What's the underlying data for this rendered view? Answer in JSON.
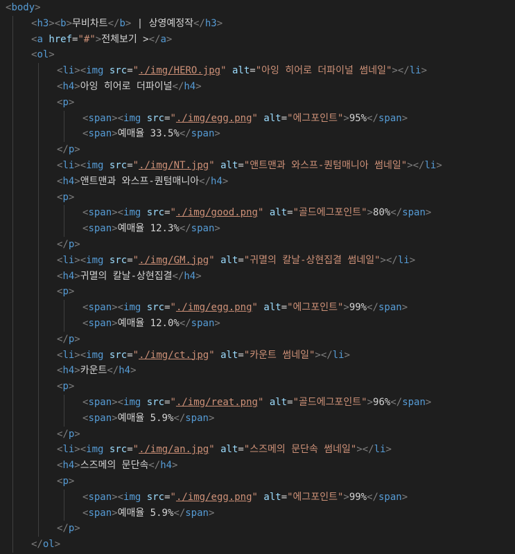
{
  "lines": [
    {
      "depth": 0,
      "tokens": [
        [
          "p",
          "<"
        ],
        [
          "t",
          "body"
        ],
        [
          "p",
          ">"
        ]
      ]
    },
    {
      "depth": 1,
      "tokens": [
        [
          "p",
          "<"
        ],
        [
          "t",
          "h3"
        ],
        [
          "p",
          ">"
        ],
        [
          "p",
          "<"
        ],
        [
          "t",
          "b"
        ],
        [
          "p",
          ">"
        ],
        [
          "x",
          "무비차트"
        ],
        [
          "p",
          "</"
        ],
        [
          "t",
          "b"
        ],
        [
          "p",
          ">"
        ],
        [
          "x",
          " | 상영예정작"
        ],
        [
          "p",
          "</"
        ],
        [
          "t",
          "h3"
        ],
        [
          "p",
          ">"
        ]
      ]
    },
    {
      "depth": 1,
      "tokens": [
        [
          "p",
          "<"
        ],
        [
          "t",
          "a"
        ],
        [
          "x",
          " "
        ],
        [
          "a",
          "href"
        ],
        [
          "e",
          "="
        ],
        [
          "s",
          "\"#\""
        ],
        [
          "p",
          ">"
        ],
        [
          "x",
          "전체보기 >"
        ],
        [
          "p",
          "</"
        ],
        [
          "t",
          "a"
        ],
        [
          "p",
          ">"
        ]
      ]
    },
    {
      "depth": 1,
      "tokens": [
        [
          "p",
          "<"
        ],
        [
          "t",
          "ol"
        ],
        [
          "p",
          ">"
        ]
      ]
    },
    {
      "depth": 2,
      "tokens": [
        [
          "p",
          "<"
        ],
        [
          "t",
          "li"
        ],
        [
          "p",
          ">"
        ],
        [
          "p",
          "<"
        ],
        [
          "t",
          "img"
        ],
        [
          "x",
          " "
        ],
        [
          "a",
          "src"
        ],
        [
          "e",
          "="
        ],
        [
          "s",
          "\""
        ],
        [
          "sl",
          "./img/HERO.jpg"
        ],
        [
          "s",
          "\""
        ],
        [
          "x",
          " "
        ],
        [
          "a",
          "alt"
        ],
        [
          "e",
          "="
        ],
        [
          "s",
          "\"아잉 히어로 더파이널 썸네일\""
        ],
        [
          "p",
          ">"
        ],
        [
          "p",
          "</"
        ],
        [
          "t",
          "li"
        ],
        [
          "p",
          ">"
        ]
      ]
    },
    {
      "depth": 2,
      "tokens": [
        [
          "p",
          "<"
        ],
        [
          "t",
          "h4"
        ],
        [
          "p",
          ">"
        ],
        [
          "x",
          "아잉 히어로 더파이널"
        ],
        [
          "p",
          "</"
        ],
        [
          "t",
          "h4"
        ],
        [
          "p",
          ">"
        ]
      ]
    },
    {
      "depth": 2,
      "tokens": [
        [
          "p",
          "<"
        ],
        [
          "t",
          "p"
        ],
        [
          "p",
          ">"
        ]
      ]
    },
    {
      "depth": 3,
      "tokens": [
        [
          "p",
          "<"
        ],
        [
          "t",
          "span"
        ],
        [
          "p",
          ">"
        ],
        [
          "p",
          "<"
        ],
        [
          "t",
          "img"
        ],
        [
          "x",
          " "
        ],
        [
          "a",
          "src"
        ],
        [
          "e",
          "="
        ],
        [
          "s",
          "\""
        ],
        [
          "sl",
          "./img/egg.png"
        ],
        [
          "s",
          "\""
        ],
        [
          "x",
          " "
        ],
        [
          "a",
          "alt"
        ],
        [
          "e",
          "="
        ],
        [
          "s",
          "\"에그포인트\""
        ],
        [
          "p",
          ">"
        ],
        [
          "x",
          "95%"
        ],
        [
          "p",
          "</"
        ],
        [
          "t",
          "span"
        ],
        [
          "p",
          ">"
        ]
      ]
    },
    {
      "depth": 3,
      "tokens": [
        [
          "p",
          "<"
        ],
        [
          "t",
          "span"
        ],
        [
          "p",
          ">"
        ],
        [
          "x",
          "예매율 33.5%"
        ],
        [
          "p",
          "</"
        ],
        [
          "t",
          "span"
        ],
        [
          "p",
          ">"
        ]
      ]
    },
    {
      "depth": 2,
      "tokens": [
        [
          "p",
          "</"
        ],
        [
          "t",
          "p"
        ],
        [
          "p",
          ">"
        ]
      ]
    },
    {
      "depth": 2,
      "tokens": [
        [
          "p",
          "<"
        ],
        [
          "t",
          "li"
        ],
        [
          "p",
          ">"
        ],
        [
          "p",
          "<"
        ],
        [
          "t",
          "img"
        ],
        [
          "x",
          " "
        ],
        [
          "a",
          "src"
        ],
        [
          "e",
          "="
        ],
        [
          "s",
          "\""
        ],
        [
          "sl",
          "./img/NT.jpg"
        ],
        [
          "s",
          "\""
        ],
        [
          "x",
          " "
        ],
        [
          "a",
          "alt"
        ],
        [
          "e",
          "="
        ],
        [
          "s",
          "\"앤트맨과 와스프-퀀텀매니아 썸네일\""
        ],
        [
          "p",
          ">"
        ],
        [
          "p",
          "</"
        ],
        [
          "t",
          "li"
        ],
        [
          "p",
          ">"
        ]
      ]
    },
    {
      "depth": 2,
      "tokens": [
        [
          "p",
          "<"
        ],
        [
          "t",
          "h4"
        ],
        [
          "p",
          ">"
        ],
        [
          "x",
          "앤트맨과 와스프-퀀텀매니아"
        ],
        [
          "p",
          "</"
        ],
        [
          "t",
          "h4"
        ],
        [
          "p",
          ">"
        ]
      ]
    },
    {
      "depth": 2,
      "tokens": [
        [
          "p",
          "<"
        ],
        [
          "t",
          "p"
        ],
        [
          "p",
          ">"
        ]
      ]
    },
    {
      "depth": 3,
      "tokens": [
        [
          "p",
          "<"
        ],
        [
          "t",
          "span"
        ],
        [
          "p",
          ">"
        ],
        [
          "p",
          "<"
        ],
        [
          "t",
          "img"
        ],
        [
          "x",
          " "
        ],
        [
          "a",
          "src"
        ],
        [
          "e",
          "="
        ],
        [
          "s",
          "\""
        ],
        [
          "sl",
          "./img/good.png"
        ],
        [
          "s",
          "\""
        ],
        [
          "x",
          " "
        ],
        [
          "a",
          "alt"
        ],
        [
          "e",
          "="
        ],
        [
          "s",
          "\"골드에그포인트\""
        ],
        [
          "p",
          ">"
        ],
        [
          "x",
          "80%"
        ],
        [
          "p",
          "</"
        ],
        [
          "t",
          "span"
        ],
        [
          "p",
          ">"
        ]
      ]
    },
    {
      "depth": 3,
      "tokens": [
        [
          "p",
          "<"
        ],
        [
          "t",
          "span"
        ],
        [
          "p",
          ">"
        ],
        [
          "x",
          "예매율 12.3%"
        ],
        [
          "p",
          "</"
        ],
        [
          "t",
          "span"
        ],
        [
          "p",
          ">"
        ]
      ]
    },
    {
      "depth": 2,
      "tokens": [
        [
          "p",
          "</"
        ],
        [
          "t",
          "p"
        ],
        [
          "p",
          ">"
        ]
      ]
    },
    {
      "depth": 2,
      "tokens": [
        [
          "p",
          "<"
        ],
        [
          "t",
          "li"
        ],
        [
          "p",
          ">"
        ],
        [
          "p",
          "<"
        ],
        [
          "t",
          "img"
        ],
        [
          "x",
          " "
        ],
        [
          "a",
          "src"
        ],
        [
          "e",
          "="
        ],
        [
          "s",
          "\""
        ],
        [
          "sl",
          "./img/GM.jpg"
        ],
        [
          "s",
          "\""
        ],
        [
          "x",
          " "
        ],
        [
          "a",
          "alt"
        ],
        [
          "e",
          "="
        ],
        [
          "s",
          "\"귀멸의 칼날-상현집결 썸네일\""
        ],
        [
          "p",
          ">"
        ],
        [
          "p",
          "</"
        ],
        [
          "t",
          "li"
        ],
        [
          "p",
          ">"
        ]
      ]
    },
    {
      "depth": 2,
      "tokens": [
        [
          "p",
          "<"
        ],
        [
          "t",
          "h4"
        ],
        [
          "p",
          ">"
        ],
        [
          "x",
          "귀멸의 칼날-상현집결"
        ],
        [
          "p",
          "</"
        ],
        [
          "t",
          "h4"
        ],
        [
          "p",
          ">"
        ]
      ]
    },
    {
      "depth": 2,
      "tokens": [
        [
          "p",
          "<"
        ],
        [
          "t",
          "p"
        ],
        [
          "p",
          ">"
        ]
      ]
    },
    {
      "depth": 3,
      "tokens": [
        [
          "p",
          "<"
        ],
        [
          "t",
          "span"
        ],
        [
          "p",
          ">"
        ],
        [
          "p",
          "<"
        ],
        [
          "t",
          "img"
        ],
        [
          "x",
          " "
        ],
        [
          "a",
          "src"
        ],
        [
          "e",
          "="
        ],
        [
          "s",
          "\""
        ],
        [
          "sl",
          "./img/egg.png"
        ],
        [
          "s",
          "\""
        ],
        [
          "x",
          " "
        ],
        [
          "a",
          "alt"
        ],
        [
          "e",
          "="
        ],
        [
          "s",
          "\"에그포인트\""
        ],
        [
          "p",
          ">"
        ],
        [
          "x",
          "99%"
        ],
        [
          "p",
          "</"
        ],
        [
          "t",
          "span"
        ],
        [
          "p",
          ">"
        ]
      ]
    },
    {
      "depth": 3,
      "tokens": [
        [
          "p",
          "<"
        ],
        [
          "t",
          "span"
        ],
        [
          "p",
          ">"
        ],
        [
          "x",
          "예매율 12.0%"
        ],
        [
          "p",
          "</"
        ],
        [
          "t",
          "span"
        ],
        [
          "p",
          ">"
        ]
      ]
    },
    {
      "depth": 2,
      "tokens": [
        [
          "p",
          "</"
        ],
        [
          "t",
          "p"
        ],
        [
          "p",
          ">"
        ]
      ]
    },
    {
      "depth": 2,
      "tokens": [
        [
          "p",
          "<"
        ],
        [
          "t",
          "li"
        ],
        [
          "p",
          ">"
        ],
        [
          "p",
          "<"
        ],
        [
          "t",
          "img"
        ],
        [
          "x",
          " "
        ],
        [
          "a",
          "src"
        ],
        [
          "e",
          "="
        ],
        [
          "s",
          "\""
        ],
        [
          "sl",
          "./img/ct.jpg"
        ],
        [
          "s",
          "\""
        ],
        [
          "x",
          " "
        ],
        [
          "a",
          "alt"
        ],
        [
          "e",
          "="
        ],
        [
          "s",
          "\"카운트 썸네일\""
        ],
        [
          "p",
          ">"
        ],
        [
          "p",
          "</"
        ],
        [
          "t",
          "li"
        ],
        [
          "p",
          ">"
        ]
      ]
    },
    {
      "depth": 2,
      "tokens": [
        [
          "p",
          "<"
        ],
        [
          "t",
          "h4"
        ],
        [
          "p",
          ">"
        ],
        [
          "x",
          "카운트"
        ],
        [
          "p",
          "</"
        ],
        [
          "t",
          "h4"
        ],
        [
          "p",
          ">"
        ]
      ]
    },
    {
      "depth": 2,
      "tokens": [
        [
          "p",
          "<"
        ],
        [
          "t",
          "p"
        ],
        [
          "p",
          ">"
        ]
      ]
    },
    {
      "depth": 3,
      "tokens": [
        [
          "p",
          "<"
        ],
        [
          "t",
          "span"
        ],
        [
          "p",
          ">"
        ],
        [
          "p",
          "<"
        ],
        [
          "t",
          "img"
        ],
        [
          "x",
          " "
        ],
        [
          "a",
          "src"
        ],
        [
          "e",
          "="
        ],
        [
          "s",
          "\""
        ],
        [
          "sl",
          "./img/reat.png"
        ],
        [
          "s",
          "\""
        ],
        [
          "x",
          " "
        ],
        [
          "a",
          "alt"
        ],
        [
          "e",
          "="
        ],
        [
          "s",
          "\"골드에그포인트\""
        ],
        [
          "p",
          ">"
        ],
        [
          "x",
          "96%"
        ],
        [
          "p",
          "</"
        ],
        [
          "t",
          "span"
        ],
        [
          "p",
          ">"
        ]
      ]
    },
    {
      "depth": 3,
      "tokens": [
        [
          "p",
          "<"
        ],
        [
          "t",
          "span"
        ],
        [
          "p",
          ">"
        ],
        [
          "x",
          "예매율 5.9%"
        ],
        [
          "p",
          "</"
        ],
        [
          "t",
          "span"
        ],
        [
          "p",
          ">"
        ]
      ]
    },
    {
      "depth": 2,
      "tokens": [
        [
          "p",
          "</"
        ],
        [
          "t",
          "p"
        ],
        [
          "p",
          ">"
        ]
      ]
    },
    {
      "depth": 2,
      "tokens": [
        [
          "p",
          "<"
        ],
        [
          "t",
          "li"
        ],
        [
          "p",
          ">"
        ],
        [
          "p",
          "<"
        ],
        [
          "t",
          "img"
        ],
        [
          "x",
          " "
        ],
        [
          "a",
          "src"
        ],
        [
          "e",
          "="
        ],
        [
          "s",
          "\""
        ],
        [
          "sl",
          "./img/an.jpg"
        ],
        [
          "s",
          "\""
        ],
        [
          "x",
          " "
        ],
        [
          "a",
          "alt"
        ],
        [
          "e",
          "="
        ],
        [
          "s",
          "\"스즈메의 문단속 썸네일\""
        ],
        [
          "p",
          ">"
        ],
        [
          "p",
          "</"
        ],
        [
          "t",
          "li"
        ],
        [
          "p",
          ">"
        ]
      ]
    },
    {
      "depth": 2,
      "tokens": [
        [
          "p",
          "<"
        ],
        [
          "t",
          "h4"
        ],
        [
          "p",
          ">"
        ],
        [
          "x",
          "스즈메의 문단속"
        ],
        [
          "p",
          "</"
        ],
        [
          "t",
          "h4"
        ],
        [
          "p",
          ">"
        ]
      ]
    },
    {
      "depth": 2,
      "tokens": [
        [
          "p",
          "<"
        ],
        [
          "t",
          "p"
        ],
        [
          "p",
          ">"
        ]
      ]
    },
    {
      "depth": 3,
      "tokens": [
        [
          "p",
          "<"
        ],
        [
          "t",
          "span"
        ],
        [
          "p",
          ">"
        ],
        [
          "p",
          "<"
        ],
        [
          "t",
          "img"
        ],
        [
          "x",
          " "
        ],
        [
          "a",
          "src"
        ],
        [
          "e",
          "="
        ],
        [
          "s",
          "\""
        ],
        [
          "sl",
          "./img/egg.png"
        ],
        [
          "s",
          "\""
        ],
        [
          "x",
          " "
        ],
        [
          "a",
          "alt"
        ],
        [
          "e",
          "="
        ],
        [
          "s",
          "\"에그포인트\""
        ],
        [
          "p",
          ">"
        ],
        [
          "x",
          "99%"
        ],
        [
          "p",
          "</"
        ],
        [
          "t",
          "span"
        ],
        [
          "p",
          ">"
        ]
      ]
    },
    {
      "depth": 3,
      "tokens": [
        [
          "p",
          "<"
        ],
        [
          "t",
          "span"
        ],
        [
          "p",
          ">"
        ],
        [
          "x",
          "예매율 5.9%"
        ],
        [
          "p",
          "</"
        ],
        [
          "t",
          "span"
        ],
        [
          "p",
          ">"
        ]
      ]
    },
    {
      "depth": 2,
      "tokens": [
        [
          "p",
          "</"
        ],
        [
          "t",
          "p"
        ],
        [
          "p",
          ">"
        ]
      ]
    },
    {
      "depth": 1,
      "tokens": [
        [
          "p",
          "</"
        ],
        [
          "t",
          "ol"
        ],
        [
          "p",
          ">"
        ]
      ]
    }
  ]
}
